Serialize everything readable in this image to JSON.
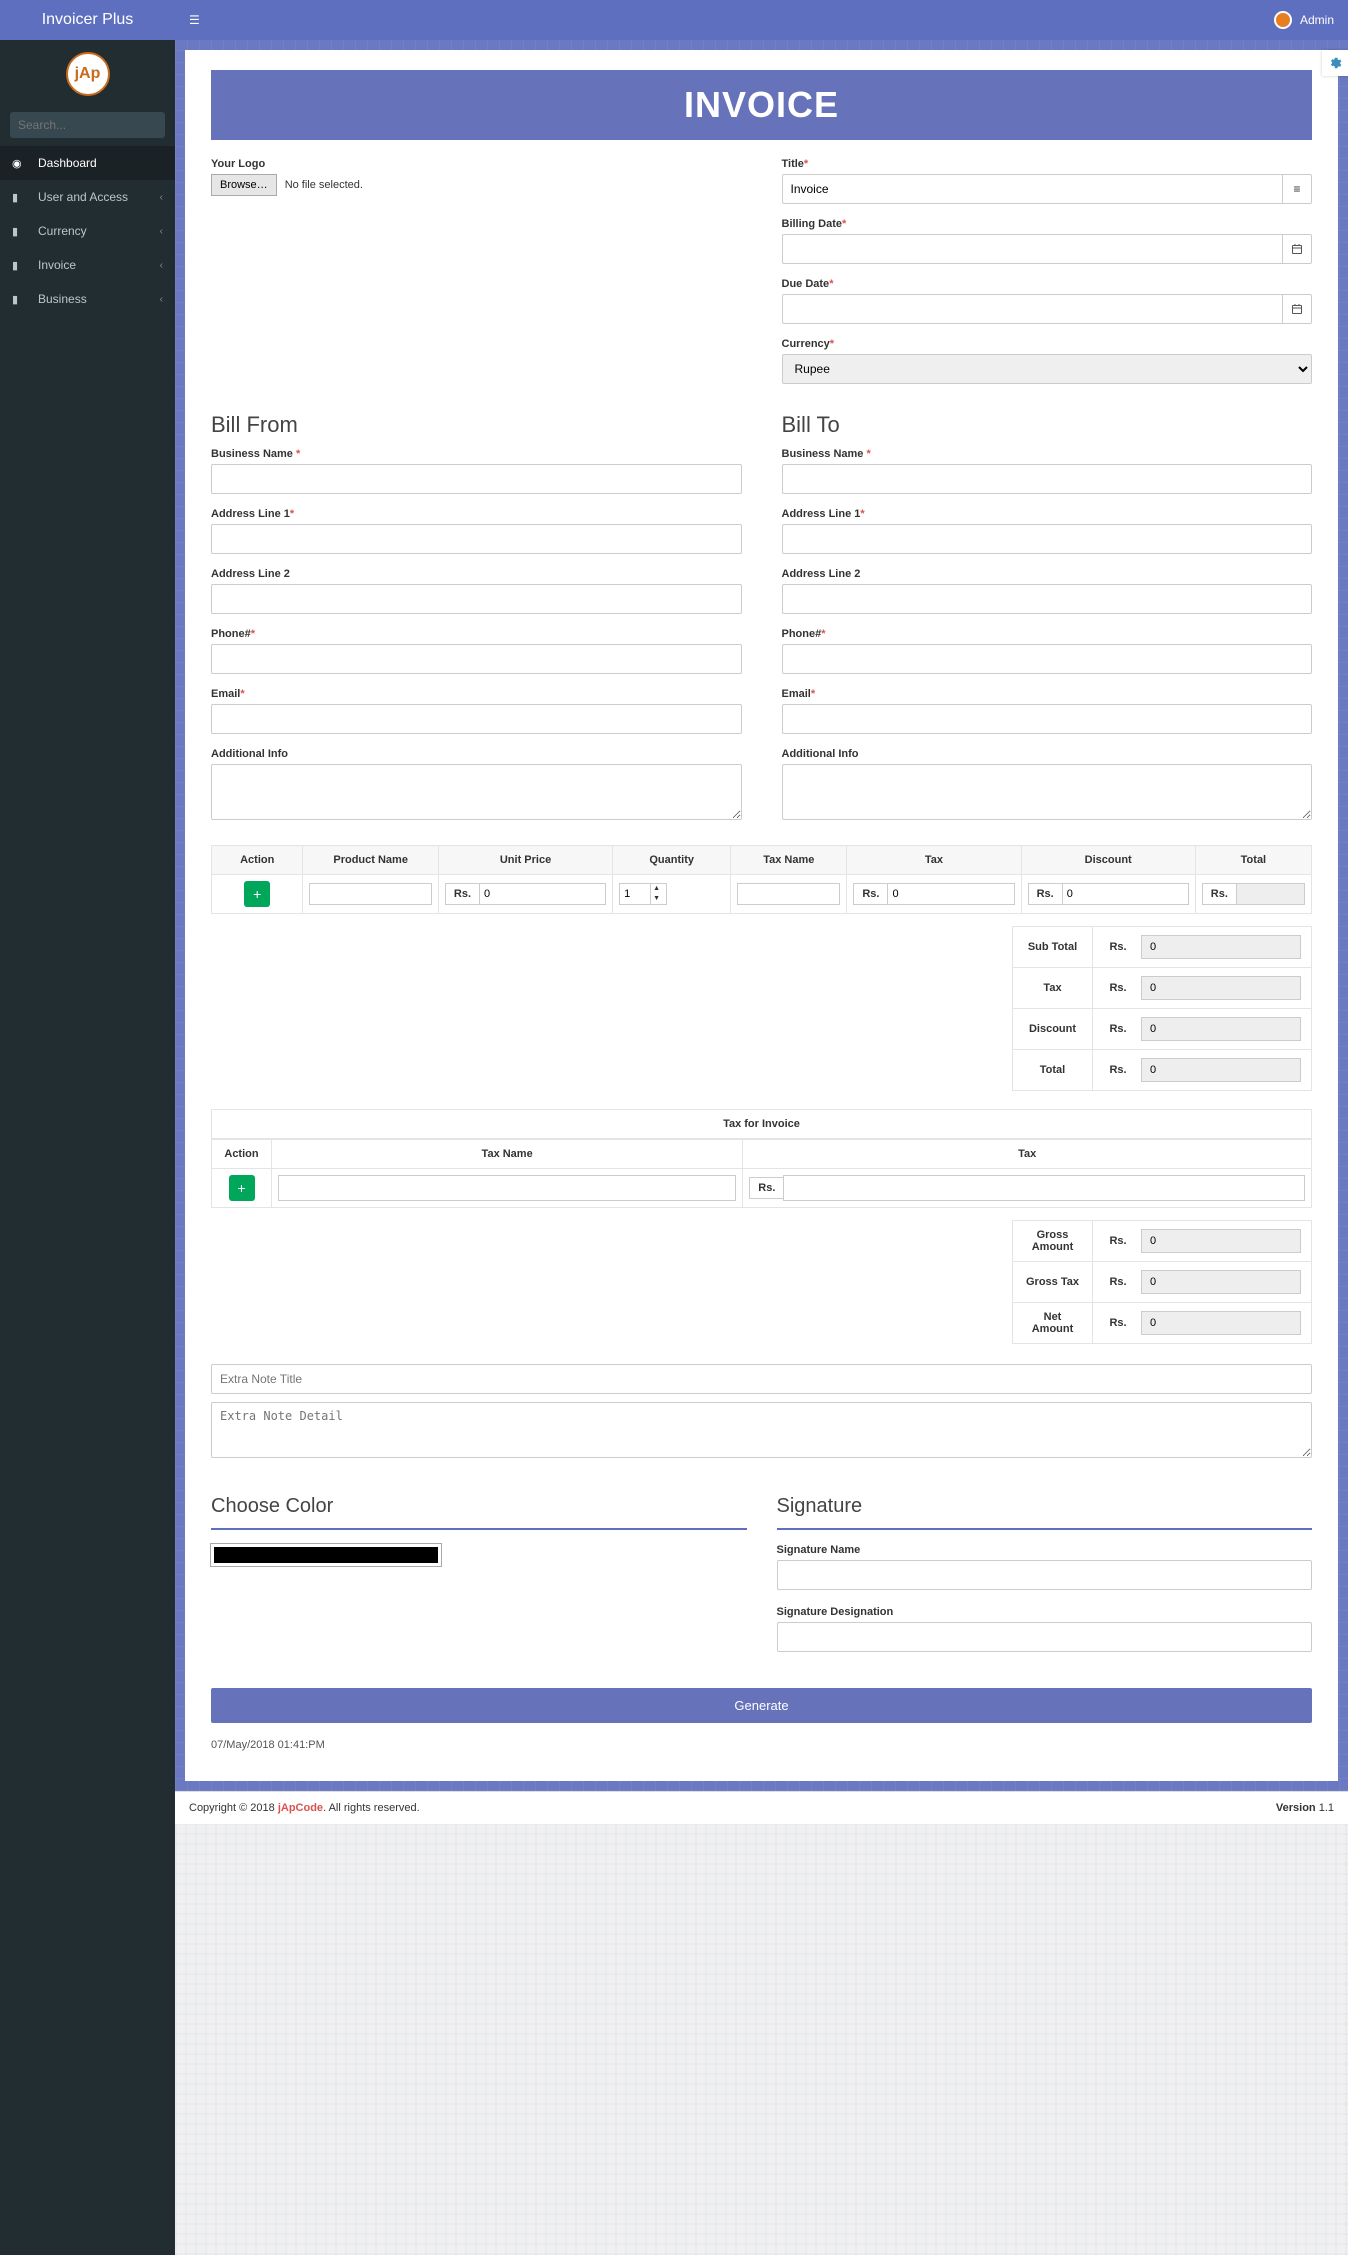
{
  "brand": "Invoicer Plus",
  "user": {
    "name": "Admin"
  },
  "search": {
    "placeholder": "Search..."
  },
  "nav": [
    {
      "label": "Dashboard",
      "active": true,
      "expandable": false
    },
    {
      "label": "User and Access",
      "active": false,
      "expandable": true
    },
    {
      "label": "Currency",
      "active": false,
      "expandable": true
    },
    {
      "label": "Invoice",
      "active": false,
      "expandable": true
    },
    {
      "label": "Business",
      "active": false,
      "expandable": true
    }
  ],
  "banner": "INVOICE",
  "logo_section": {
    "label": "Your Logo",
    "browse": "Browse…",
    "status": "No file selected."
  },
  "meta": {
    "title_label": "Title",
    "title_value": "Invoice",
    "billing_date_label": "Billing Date",
    "due_date_label": "Due Date",
    "currency_label": "Currency",
    "currency_value": "Rupee"
  },
  "bill_from": {
    "heading": "Bill From",
    "business_label": "Business Name",
    "addr1_label": "Address Line 1",
    "addr2_label": "Address Line 2",
    "phone_label": "Phone#",
    "email_label": "Email",
    "addl_label": "Additional Info"
  },
  "bill_to": {
    "heading": "Bill To",
    "business_label": "Business Name",
    "addr1_label": "Address Line 1",
    "addr2_label": "Address Line 2",
    "phone_label": "Phone#",
    "email_label": "Email",
    "addl_label": "Additional Info"
  },
  "items_table": {
    "headers": {
      "action": "Action",
      "product": "Product Name",
      "unit_price": "Unit Price",
      "quantity": "Quantity",
      "tax_name": "Tax Name",
      "tax": "Tax",
      "discount": "Discount",
      "total": "Total"
    },
    "row": {
      "currency_prefix": "Rs.",
      "unit_price": "0",
      "quantity": "1",
      "tax": "0",
      "discount": "0",
      "total": ""
    }
  },
  "summary": {
    "subtotal_label": "Sub Total",
    "subtotal": "0",
    "tax_label": "Tax",
    "tax": "0",
    "discount_label": "Discount",
    "discount": "0",
    "total_label": "Total",
    "total": "0",
    "prefix": "Rs."
  },
  "tax_section": {
    "title": "Tax for Invoice",
    "headers": {
      "action": "Action",
      "tax_name": "Tax Name",
      "tax": "Tax"
    },
    "row_prefix": "Rs."
  },
  "grand": {
    "gross_label": "Gross Amount",
    "gross": "0",
    "gross_tax_label": "Gross Tax",
    "gross_tax": "0",
    "net_label": "Net Amount",
    "net": "0",
    "prefix": "Rs."
  },
  "notes": {
    "title_placeholder": "Extra Note Title",
    "detail_placeholder": "Extra Note Detail"
  },
  "color": {
    "heading": "Choose Color"
  },
  "signature": {
    "heading": "Signature",
    "name_label": "Signature Name",
    "desig_label": "Signature Designation"
  },
  "generate_label": "Generate",
  "timestamp": "07/May/2018 01:41:PM",
  "footer": {
    "copyright_prefix": "Copyright © 2018 ",
    "brand": "jApCode",
    "suffix": ". All rights reserved.",
    "version_label": "Version ",
    "version": "1.1"
  }
}
